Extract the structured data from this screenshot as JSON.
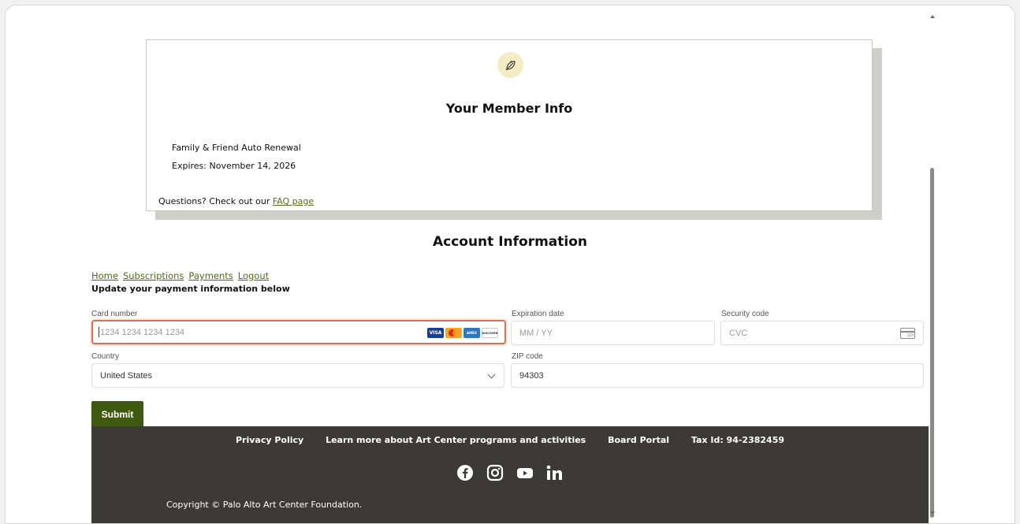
{
  "card": {
    "title": "Your Member Info",
    "membership": "Family & Friend Auto Renewal",
    "expires": "Expires: November 14, 2026",
    "faq_prefix": "Questions? Check out our ",
    "faq_link": "FAQ page"
  },
  "account": {
    "title": "Account Information",
    "nav": [
      "Home",
      "Subscriptions",
      "Payments",
      "Logout"
    ],
    "update_label": "Update your payment information below"
  },
  "payment": {
    "card_number_label": "Card number",
    "card_number_placeholder": "1234 1234 1234 1234",
    "card_brands": [
      "VISA",
      "MasterCard",
      "AMEX",
      "DISCOVER"
    ],
    "expiration_label": "Expiration date",
    "expiration_placeholder": "MM / YY",
    "security_label": "Security code",
    "security_placeholder": "CVC",
    "cvc_icon_text": "123",
    "country_label": "Country",
    "country_value": "United States",
    "zip_label": "ZIP code",
    "zip_value": "94303",
    "submit_label": "Submit"
  },
  "footer": {
    "links": [
      "Privacy Policy",
      "Learn more about Art Center programs and activities",
      "Board Portal",
      "Tax Id: 94-2382459"
    ],
    "socials": [
      "facebook-icon",
      "instagram-icon",
      "youtube-icon",
      "linkedin-icon"
    ],
    "copyright": "Copyright © Palo Alto Art Center Foundation."
  },
  "colors": {
    "accent": "#3f5a0e",
    "link": "#4d6b14",
    "focus": "#e06f4f",
    "footer_bg": "#3b3a36"
  }
}
